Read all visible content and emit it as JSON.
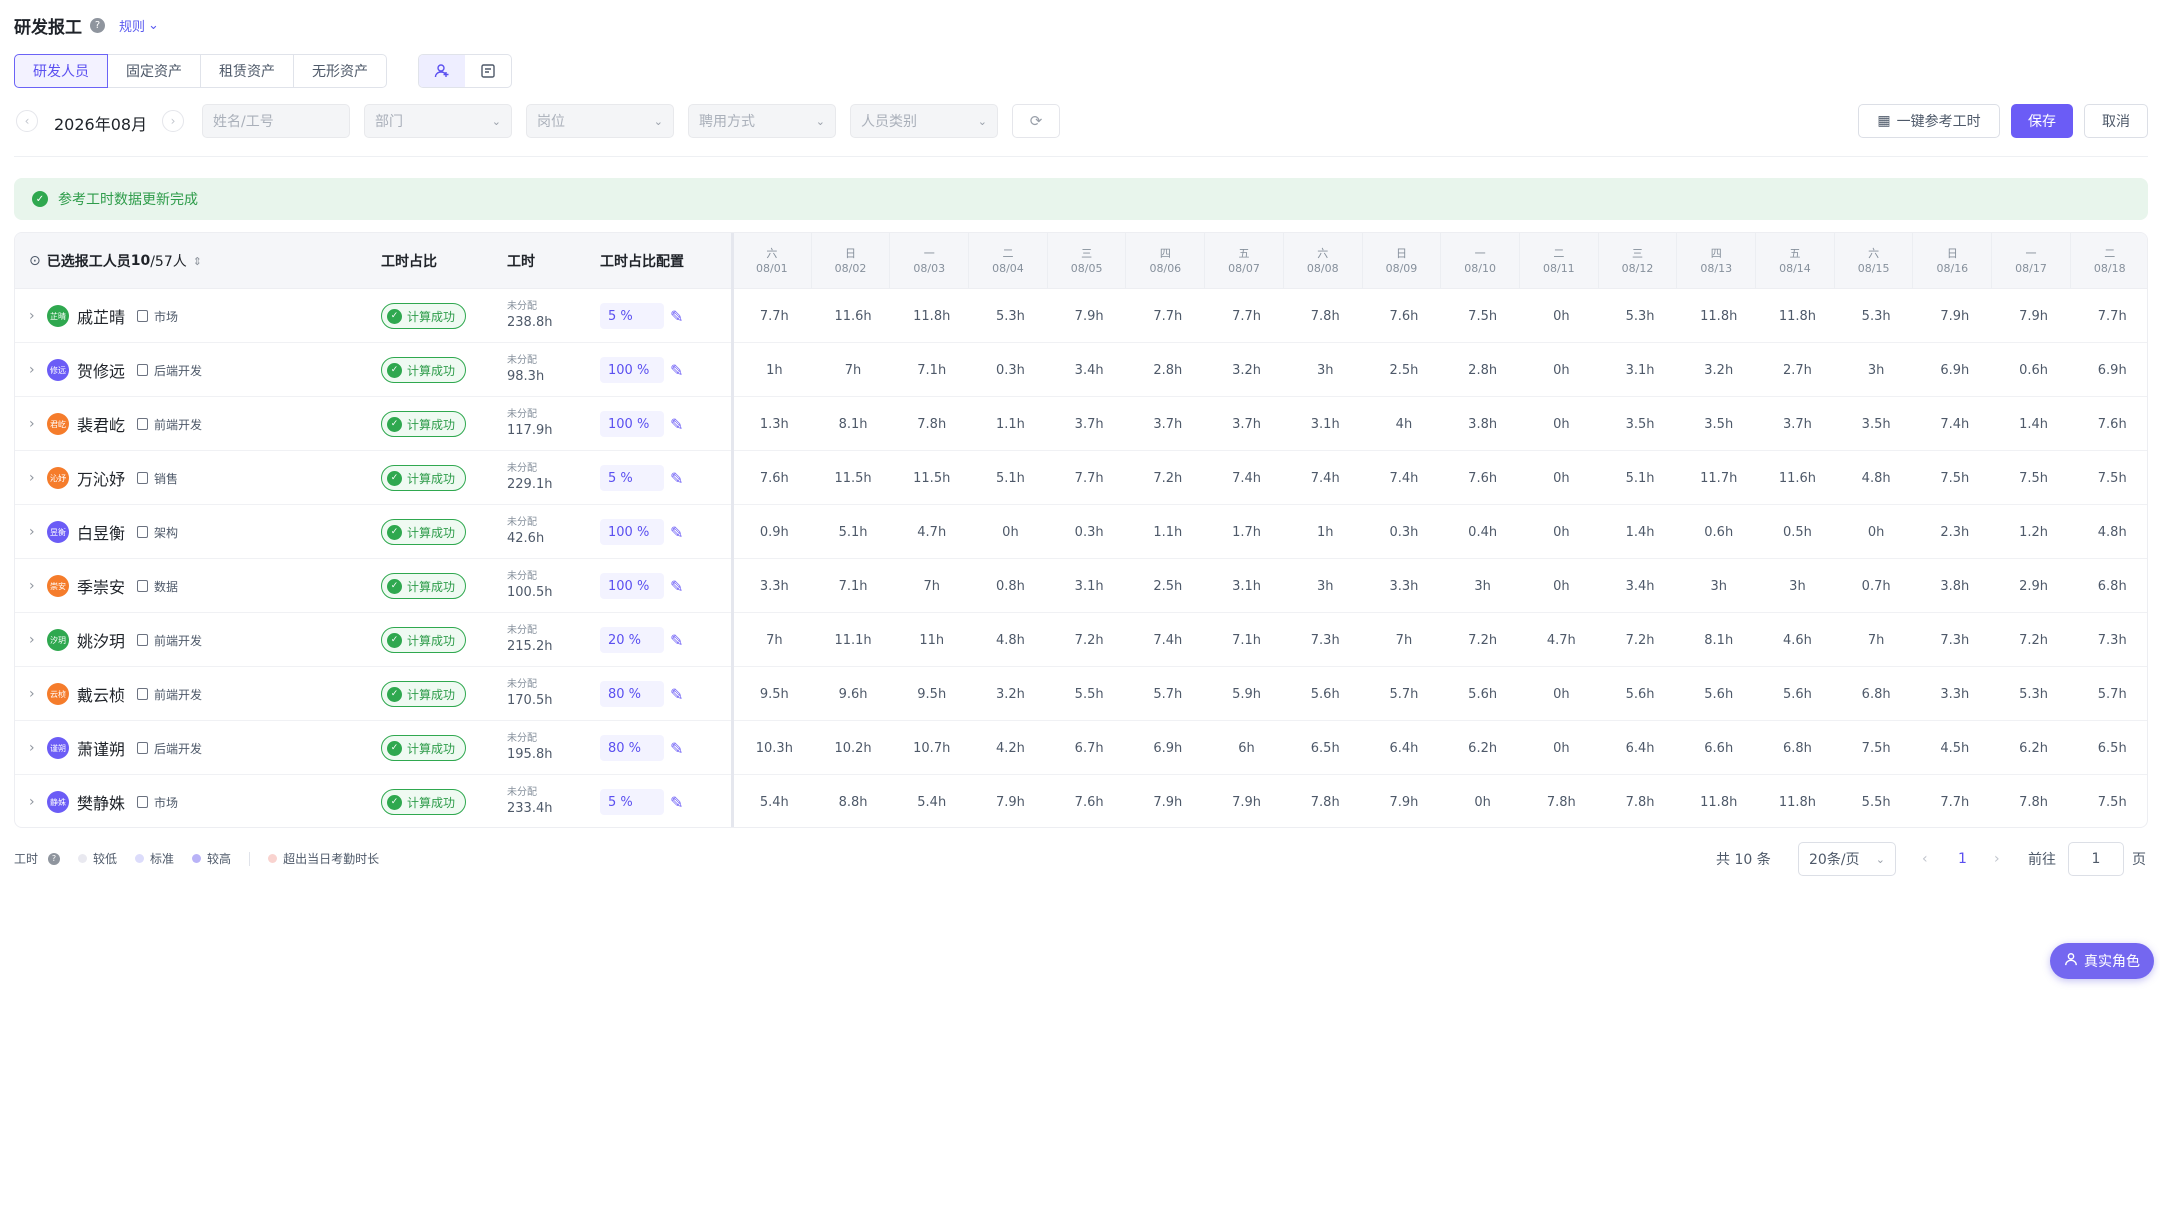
{
  "header": {
    "title": "研发报工",
    "rule_label": "规则"
  },
  "tabs": [
    "研发人员",
    "固定资产",
    "租赁资产",
    "无形资产"
  ],
  "active_tab": 0,
  "filters": {
    "month": "2026年08月",
    "name_placeholder": "姓名/工号",
    "department": "部门",
    "position": "岗位",
    "employment": "聘用方式",
    "category": "人员类别"
  },
  "buttons": {
    "reference": "一键参考工时",
    "save": "保存",
    "cancel": "取消"
  },
  "alert": "参考工时数据更新完成",
  "table": {
    "selected_label": "已选报工人员",
    "selected_count": "10",
    "total_label": "/57人",
    "col_ratio": "工时占比",
    "col_hours": "工时",
    "col_config": "工时占比配置",
    "days": [
      {
        "w": "六",
        "d": "08/01"
      },
      {
        "w": "日",
        "d": "08/02"
      },
      {
        "w": "一",
        "d": "08/03"
      },
      {
        "w": "二",
        "d": "08/04"
      },
      {
        "w": "三",
        "d": "08/05"
      },
      {
        "w": "四",
        "d": "08/06"
      },
      {
        "w": "五",
        "d": "08/07"
      },
      {
        "w": "六",
        "d": "08/08"
      },
      {
        "w": "日",
        "d": "08/09"
      },
      {
        "w": "一",
        "d": "08/10"
      },
      {
        "w": "二",
        "d": "08/11"
      },
      {
        "w": "三",
        "d": "08/12"
      },
      {
        "w": "四",
        "d": "08/13"
      },
      {
        "w": "五",
        "d": "08/14"
      },
      {
        "w": "六",
        "d": "08/15"
      },
      {
        "w": "日",
        "d": "08/16"
      },
      {
        "w": "一",
        "d": "08/17"
      },
      {
        "w": "二",
        "d": "08/18"
      }
    ],
    "status_text": "计算成功",
    "unassigned_label": "未分配",
    "rows": [
      {
        "name": "戚芷晴",
        "avatar": "芷晴",
        "color": "#2fa84f",
        "dept": "市场",
        "hours": "238.8h",
        "pct": "5 %",
        "vals": [
          "7.7h",
          "11.6h",
          "11.8h",
          "5.3h",
          "7.9h",
          "7.7h",
          "7.7h",
          "7.8h",
          "7.6h",
          "7.5h",
          "0h",
          "5.3h",
          "11.8h",
          "11.8h",
          "5.3h",
          "7.9h",
          "7.9h",
          "7.7h"
        ]
      },
      {
        "name": "贺修远",
        "avatar": "修远",
        "color": "#6b5cf6",
        "dept": "后端开发",
        "hours": "98.3h",
        "pct": "100 %",
        "vals": [
          "1h",
          "7h",
          "7.1h",
          "0.3h",
          "3.4h",
          "2.8h",
          "3.2h",
          "3h",
          "2.5h",
          "2.8h",
          "0h",
          "3.1h",
          "3.2h",
          "2.7h",
          "3h",
          "6.9h",
          "0.6h",
          "6.9h"
        ]
      },
      {
        "name": "裴君屹",
        "avatar": "君屹",
        "color": "#f57c2b",
        "dept": "前端开发",
        "hours": "117.9h",
        "pct": "100 %",
        "vals": [
          "1.3h",
          "8.1h",
          "7.8h",
          "1.1h",
          "3.7h",
          "3.7h",
          "3.7h",
          "3.1h",
          "4h",
          "3.8h",
          "0h",
          "3.5h",
          "3.5h",
          "3.7h",
          "3.5h",
          "7.4h",
          "1.4h",
          "7.6h"
        ]
      },
      {
        "name": "万沁妤",
        "avatar": "沁妤",
        "color": "#f57c2b",
        "dept": "销售",
        "hours": "229.1h",
        "pct": "5 %",
        "vals": [
          "7.6h",
          "11.5h",
          "11.5h",
          "5.1h",
          "7.7h",
          "7.2h",
          "7.4h",
          "7.4h",
          "7.4h",
          "7.6h",
          "0h",
          "5.1h",
          "11.7h",
          "11.6h",
          "4.8h",
          "7.5h",
          "7.5h",
          "7.5h"
        ]
      },
      {
        "name": "白昱衡",
        "avatar": "昱衡",
        "color": "#6b5cf6",
        "dept": "架构",
        "hours": "42.6h",
        "pct": "100 %",
        "vals": [
          "0.9h",
          "5.1h",
          "4.7h",
          "0h",
          "0.3h",
          "1.1h",
          "1.7h",
          "1h",
          "0.3h",
          "0.4h",
          "0h",
          "1.4h",
          "0.6h",
          "0.5h",
          "0h",
          "2.3h",
          "1.2h",
          "4.8h"
        ]
      },
      {
        "name": "季崇安",
        "avatar": "崇安",
        "color": "#f57c2b",
        "dept": "数据",
        "hours": "100.5h",
        "pct": "100 %",
        "vals": [
          "3.3h",
          "7.1h",
          "7h",
          "0.8h",
          "3.1h",
          "2.5h",
          "3.1h",
          "3h",
          "3.3h",
          "3h",
          "0h",
          "3.4h",
          "3h",
          "3h",
          "0.7h",
          "3.8h",
          "2.9h",
          "6.8h"
        ]
      },
      {
        "name": "姚汐玥",
        "avatar": "汐玥",
        "color": "#2fa84f",
        "dept": "前端开发",
        "hours": "215.2h",
        "pct": "20 %",
        "vals": [
          "7h",
          "11.1h",
          "11h",
          "4.8h",
          "7.2h",
          "7.4h",
          "7.1h",
          "7.3h",
          "7h",
          "7.2h",
          "4.7h",
          "7.2h",
          "8.1h",
          "4.6h",
          "7h",
          "7.3h",
          "7.2h",
          "7.3h"
        ]
      },
      {
        "name": "戴云桢",
        "avatar": "云桢",
        "color": "#f57c2b",
        "dept": "前端开发",
        "hours": "170.5h",
        "pct": "80 %",
        "vals": [
          "9.5h",
          "9.6h",
          "9.5h",
          "3.2h",
          "5.5h",
          "5.7h",
          "5.9h",
          "5.6h",
          "5.7h",
          "5.6h",
          "0h",
          "5.6h",
          "5.6h",
          "5.6h",
          "6.8h",
          "3.3h",
          "5.3h",
          "5.7h"
        ]
      },
      {
        "name": "萧谨朔",
        "avatar": "谨朔",
        "color": "#6b5cf6",
        "dept": "后端开发",
        "hours": "195.8h",
        "pct": "80 %",
        "vals": [
          "10.3h",
          "10.2h",
          "10.7h",
          "4.2h",
          "6.7h",
          "6.9h",
          "6h",
          "6.5h",
          "6.4h",
          "6.2h",
          "0h",
          "6.4h",
          "6.6h",
          "6.8h",
          "7.5h",
          "4.5h",
          "6.2h",
          "6.5h"
        ]
      },
      {
        "name": "樊静姝",
        "avatar": "静姝",
        "color": "#6b5cf6",
        "dept": "市场",
        "hours": "233.4h",
        "pct": "5 %",
        "vals": [
          "5.4h",
          "8.8h",
          "5.4h",
          "7.9h",
          "7.6h",
          "7.9h",
          "7.9h",
          "7.8h",
          "7.9h",
          "0h",
          "7.8h",
          "7.8h",
          "11.8h",
          "11.8h",
          "5.5h",
          "7.7h",
          "7.8h",
          "7.5h"
        ]
      }
    ]
  },
  "legend": {
    "label": "工时",
    "items": [
      {
        "text": "较低",
        "color": "#e9e9f0"
      },
      {
        "text": "标准",
        "color": "#dcdcfb"
      },
      {
        "text": "较高",
        "color": "#b9b3f7"
      }
    ],
    "overflow": {
      "text": "超出当日考勤时长",
      "color": "#f9d3cf"
    }
  },
  "pagination": {
    "total": "共 10 条",
    "page_size": "20条/页",
    "current": "1",
    "goto_label": "前往",
    "goto_value": "1",
    "page_unit": "页"
  },
  "float_button": "真实角色"
}
